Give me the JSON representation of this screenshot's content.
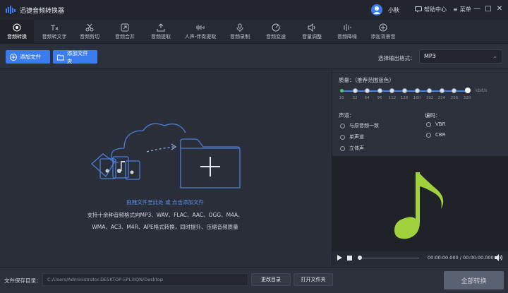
{
  "app": {
    "name": "迅捷音频转换器",
    "username": "小秋",
    "help_label": "帮助中心",
    "menu_label": "菜单",
    "minimize": "—",
    "maximize": "□",
    "close": "✕"
  },
  "tabs": [
    {
      "label": "音频转换",
      "icon": "convert-icon",
      "active": true
    },
    {
      "label": "音频转文字",
      "icon": "speech-to-text-icon"
    },
    {
      "label": "音频剪切",
      "icon": "scissors-icon"
    },
    {
      "label": "音频合并",
      "icon": "merge-icon"
    },
    {
      "label": "音频提取",
      "icon": "extract-icon"
    },
    {
      "label": "人声-伴奏提取",
      "icon": "vocal-icon"
    },
    {
      "label": "音频录制",
      "icon": "microphone-icon"
    },
    {
      "label": "音频变速",
      "icon": "speed-icon"
    },
    {
      "label": "音量调整",
      "icon": "volume-icon"
    },
    {
      "label": "音频降噪",
      "icon": "denoise-icon"
    },
    {
      "label": "添加背景音",
      "icon": "add-bgm-icon"
    }
  ],
  "toolbar": {
    "add_file": "添加文件",
    "add_folder": "添加文件夹",
    "format_label": "选择输出格式：",
    "format_value": "MP3"
  },
  "droparea": {
    "link_text": "拖拽文件至此处 或 点击添加文件",
    "desc_line1": "支持十余种音频格式向MP3、WAV、FLAC、AAC、OGG、M4A、",
    "desc_line2": "WMA、AC3、M4R、APE格式转换，同时提升、压缩音频质量"
  },
  "settings": {
    "quality_label": "质量：（推荐范围蓝色）",
    "quality_unit": "kbit/s",
    "quality_value_kbps": 320,
    "ticks": [
      "16",
      "32",
      "64",
      "96",
      "112",
      "128",
      "160",
      "192",
      "224",
      "256",
      "320"
    ],
    "channel_label": "声道：",
    "channels": [
      "与原音频一致",
      "单声道",
      "立体声"
    ],
    "encoding_label": "编码：",
    "encodings": [
      "VBR",
      "CBR"
    ]
  },
  "player": {
    "time": "00:00:00.000 / 00:00:00.000"
  },
  "bottom": {
    "output_label": "文件保存目录：",
    "output_path": "C:/Users/Administrator.DESKTOP-5PL3IQN/Desktop",
    "change_dir": "更改目录",
    "open_folder": "打开文件夹",
    "convert_all": "全部转换"
  },
  "colors": {
    "accent": "#3b7cf0",
    "note_green": "#9fd23c"
  }
}
